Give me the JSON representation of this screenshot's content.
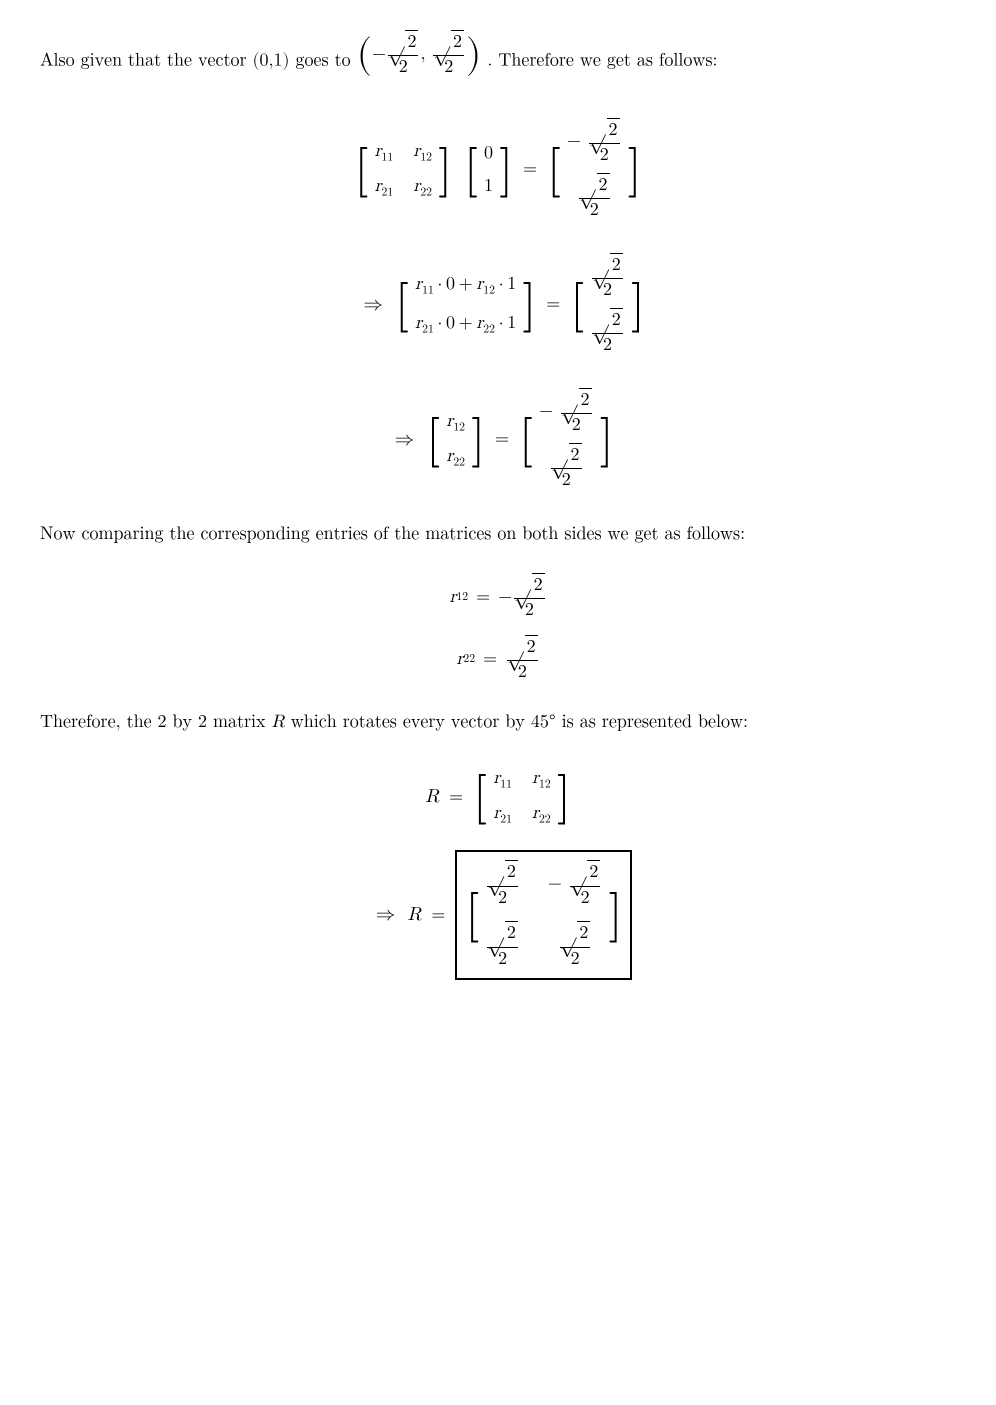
{
  "page": {
    "intro_text": "Also given that the vector (0,1) goes to",
    "intro_vector_display": "(-√2/2, √2/2)",
    "intro_suffix": ". Therefore we get as follows:",
    "section1_label": "Now comparing the corresponding entries of the matrices on both sides we get as follows:",
    "r12_label": "r",
    "r12_sub": "12",
    "r12_equals": "=",
    "r12_value": "-√2/2",
    "r22_label": "r",
    "r22_sub": "22",
    "r22_equals": "=",
    "r22_value": "√2/2",
    "conclusion_text": "Therefore, the 2 by 2 matrix R which rotates every vector by 45° is as represented below:"
  }
}
